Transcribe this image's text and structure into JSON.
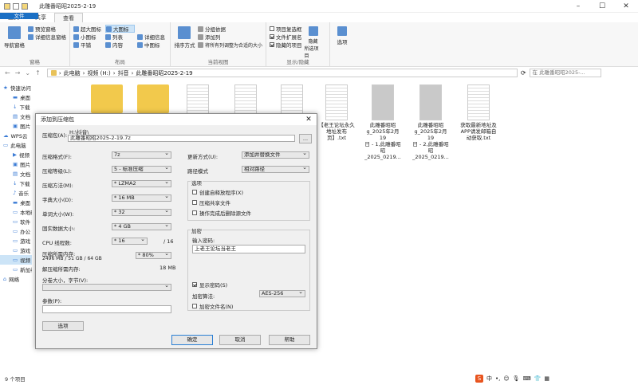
{
  "window": {
    "title": "此雕番昭昭2025-2-19"
  },
  "tabs": [
    "文件",
    "主页",
    "共享",
    "查看"
  ],
  "ribbon": {
    "pane": {
      "nav_pane": "导航窗格",
      "preview_pane": "预览窗格",
      "details_pane": "详细信息窗格",
      "label": "窗格"
    },
    "layout": {
      "items": [
        "超大图标",
        "大图标",
        "中图标",
        "小图标",
        "列表",
        "详细信息",
        "平铺",
        "内容"
      ],
      "label": "布局"
    },
    "current_view": {
      "sort": "排序方式",
      "group_by": "分组依据",
      "add_column": "添加列",
      "fit_columns": "将所有列调整为合适的大小",
      "label": "当前视图"
    },
    "show_hide": {
      "item_checkbox": "项目复选框",
      "file_ext": "文件扩展名",
      "hidden_items": "隐藏的项目",
      "hide_selected": "隐藏",
      "hide_selected2": "所选项目",
      "label": "显示/隐藏"
    },
    "options": "选项"
  },
  "address": {
    "path": [
      "此电脑",
      "视频 (H:)",
      "抖音",
      "此雕番昭昭2025-2-19"
    ],
    "search_placeholder": "在 此雕番昭昭2025-..."
  },
  "sidebar": [
    {
      "label": "快速访问",
      "icon": "star-icon",
      "sub": false
    },
    {
      "label": "桌面",
      "icon": "desktop-icon",
      "sub": true
    },
    {
      "label": "下载",
      "icon": "download-icon",
      "sub": true
    },
    {
      "label": "文档",
      "icon": "document-icon",
      "sub": true
    },
    {
      "label": "图片",
      "icon": "picture-icon",
      "sub": true
    },
    {
      "label": "WPS云",
      "icon": "cloud-icon",
      "sub": false
    },
    {
      "label": "此电脑",
      "icon": "computer-icon",
      "sub": false
    },
    {
      "label": "视频",
      "icon": "video-icon",
      "sub": true
    },
    {
      "label": "图片",
      "icon": "picture-icon",
      "sub": true
    },
    {
      "label": "文档",
      "icon": "document-icon",
      "sub": true
    },
    {
      "label": "下载",
      "icon": "download-icon",
      "sub": true
    },
    {
      "label": "音乐",
      "icon": "music-icon",
      "sub": true
    },
    {
      "label": "桌面",
      "icon": "desktop-icon",
      "sub": true
    },
    {
      "label": "本地磁",
      "icon": "drive-icon",
      "sub": true
    },
    {
      "label": "软件 (",
      "icon": "drive-icon",
      "sub": true
    },
    {
      "label": "办公 (",
      "icon": "drive-icon",
      "sub": true
    },
    {
      "label": "游戏 (",
      "icon": "drive-icon",
      "sub": true
    },
    {
      "label": "游戏",
      "icon": "drive-icon",
      "sub": true
    },
    {
      "label": "视频 (",
      "icon": "drive-icon",
      "sub": true
    },
    {
      "label": "新加卷",
      "icon": "drive-icon",
      "sub": true
    },
    {
      "label": "网络",
      "icon": "network-icon",
      "sub": false
    }
  ],
  "files": [
    {
      "name": "",
      "type": "fold"
    },
    {
      "name": "",
      "type": "fold"
    },
    {
      "name": "",
      "type": "doc"
    },
    {
      "name": "",
      "type": "doc"
    },
    {
      "name": "",
      "type": "doc"
    },
    {
      "name": "【老王论坛永久\n地址发布页】.txt",
      "type": "doc"
    },
    {
      "name": "此雕番昭昭\ng_2025年2月19\n日 - 1,此雕番昭\n昭_2025_0219...",
      "type": "img"
    },
    {
      "name": "此雕番昭昭\ng_2025年2月19\n日 - 2,此雕番昭\n昭_2025_0219...",
      "type": "img"
    },
    {
      "name": "获取最新地址及\nAPP请发邮箱自\n动获取.txt",
      "type": "doc"
    }
  ],
  "status": {
    "count": "9 个项目"
  },
  "ime": {
    "lang": "中"
  },
  "dialog": {
    "title": "添加到压缩包",
    "archive_label": "压缩包(A):",
    "archive_dir": "H:\\抖音\\",
    "archive_name": "此雕番昭昭2025-2-19.7z",
    "browse": "...",
    "format_label": "压缩格式(F):",
    "format": "7z",
    "level_label": "压缩等级(L):",
    "level": "5 - 标准压缩",
    "method_label": "压缩方法(M):",
    "method": "* LZMA2",
    "dict_label": "字典大小(D):",
    "dict": "* 16 MB",
    "word_label": "单词大小(W):",
    "word": "* 32",
    "solid_label": "固实数据大小:",
    "solid": "* 4 GB",
    "threads_label": "CPU 线程数:",
    "threads": "* 16",
    "threads_max": "/ 16",
    "mem_label": "压缩所需内存:",
    "mem_info": "2496 MB / 51 GB / 64 GB",
    "mem_pct": "* 80%",
    "decomp_label": "解压缩所需内存:",
    "decomp": "18 MB",
    "split_label": "分卷大小，字节(V):",
    "params_label": "参数(P):",
    "options_btn": "选项",
    "update_label": "更新方式(U):",
    "update": "添加并替换文件",
    "path_label": "路径模式",
    "path_mode": "相对路径",
    "opts_title": "选项",
    "sfx": "创建自释放程序(X)",
    "shared": "压缩共享文件",
    "delete": "操作完成后删除源文件",
    "enc_title": "加密",
    "pwd_label": "输入密码:",
    "pwd": "上老王论坛当老王",
    "show_pwd": "显示密码(S)",
    "enc_method_label": "加密算法:",
    "enc_method": "AES-256",
    "enc_names": "加密文件名(N)",
    "ok": "确定",
    "cancel": "取消",
    "help": "帮助"
  }
}
